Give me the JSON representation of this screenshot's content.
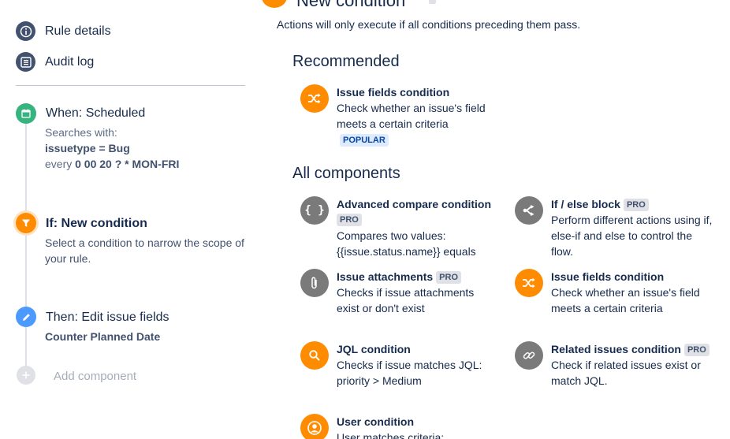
{
  "sidebar": {
    "rule_details": "Rule details",
    "audit_log": "Audit log",
    "when": {
      "title": "When: Scheduled",
      "searches_with": "Searches with:",
      "jql": "issuetype = Bug",
      "every_prefix": "every",
      "cron": "0 00 20 ? * MON-FRI"
    },
    "if": {
      "title": "If: New condition",
      "desc": "Select a condition to narrow the scope of your rule."
    },
    "then": {
      "title": "Then: Edit issue fields",
      "field": "Counter Planned Date"
    },
    "add_component": "Add component"
  },
  "main": {
    "title": "New condition",
    "subtitle": "Actions will only execute if all conditions preceding them pass.",
    "recommended_heading": "Recommended",
    "all_heading": "All components",
    "recommended": [
      {
        "title": "Issue fields condition",
        "desc": "Check whether an issue's field meets a certain criteria",
        "badge": "POPULAR",
        "icon": "shuffle-icon"
      }
    ],
    "components": [
      {
        "title": "Advanced compare condition",
        "badge": "PRO",
        "desc": "Compares two values: {{issue.status.name}} equals",
        "icon": "curly-braces-icon"
      },
      {
        "title": "If / else block",
        "badge": "PRO",
        "desc": "Perform different actions using if, else-if and else to control the flow.",
        "icon": "branch-icon"
      },
      {
        "title": "Issue attachments",
        "badge": "PRO",
        "desc": "Checks if issue attachments exist or don't exist",
        "icon": "paperclip-icon"
      },
      {
        "title": "Issue fields condition",
        "badge": "",
        "desc": "Check whether an issue's field meets a certain criteria",
        "icon": "shuffle-icon"
      },
      {
        "title": "JQL condition",
        "badge": "",
        "desc": "Checks if issue matches JQL: priority > Medium",
        "icon": "search-icon"
      },
      {
        "title": "Related issues condition",
        "badge": "PRO",
        "desc": "Check if related issues exist or match JQL.",
        "icon": "link-icon"
      },
      {
        "title": "User condition",
        "badge": "",
        "desc": "User matches criteria:",
        "icon": "user-icon"
      }
    ]
  },
  "colors": {
    "accent": "#ff8b00",
    "step_green": "#36b37e",
    "step_blue": "#4c9aff",
    "icon_grey": "#7a7a7a"
  }
}
